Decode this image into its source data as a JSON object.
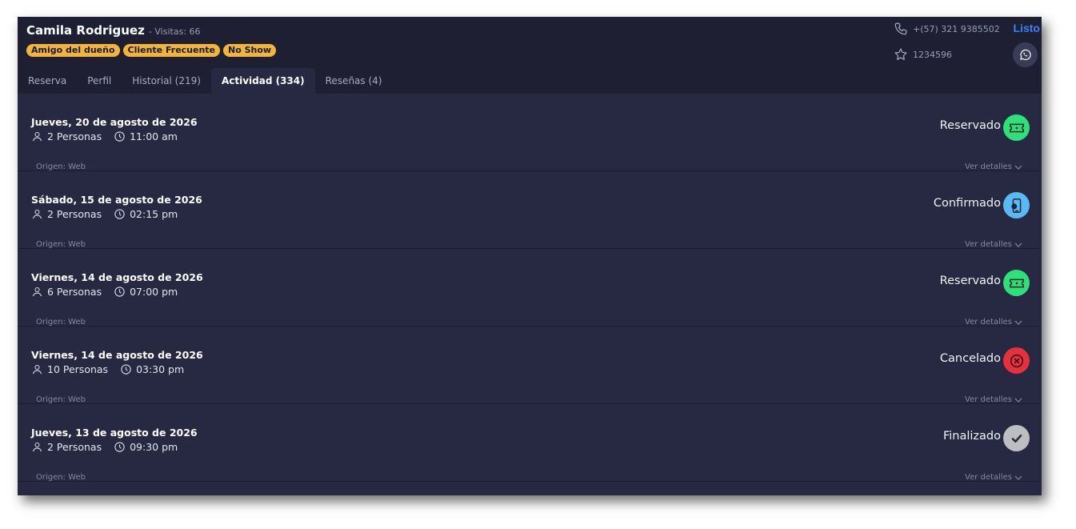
{
  "client": {
    "name": "Camila Rodriguez",
    "visits": "- Visitas: 66",
    "tags": [
      "Amigo del dueño",
      "Cliente Frecuente",
      "No Show"
    ],
    "phone": "+(57) 321 9385502",
    "member_id": "1234596",
    "done_label": "Listo"
  },
  "tabs": [
    {
      "label": "Reserva",
      "active": false
    },
    {
      "label": "Perfil",
      "active": false
    },
    {
      "label": "Historial (219)",
      "active": false
    },
    {
      "label": "Actividad (334)",
      "active": true
    },
    {
      "label": "Reseñas (4)",
      "active": false
    }
  ],
  "activity": [
    {
      "date": "Jueves, 20 de agosto de 2026",
      "people": "2 Personas",
      "time": "11:00 am",
      "origin": "Origen: Web",
      "status": "Reservado",
      "status_icon": "ticket-icon",
      "status_color": "#2fe07a",
      "details": "Ver detalles"
    },
    {
      "date": "Sábado, 15 de agosto de 2026",
      "people": "2 Personas",
      "time": "02:15 pm",
      "origin": "Origen: Web",
      "status": "Confirmado",
      "status_icon": "phone-confirm-icon",
      "status_color": "#5ab8f2",
      "details": "Ver detalles"
    },
    {
      "date": "Viernes, 14 de agosto de 2026",
      "people": "6 Personas",
      "time": "07:00 pm",
      "origin": "Origen: Web",
      "status": "Reservado",
      "status_icon": "ticket-icon",
      "status_color": "#2fe07a",
      "details": "Ver detalles"
    },
    {
      "date": "Viernes, 14 de agosto de 2026",
      "people": "10 Personas",
      "time": "03:30 pm",
      "origin": "Origen: Web",
      "status": "Cancelado",
      "status_icon": "cancel-icon",
      "status_color": "#e5313d",
      "details": "Ver detalles"
    },
    {
      "date": "Jueves, 13 de agosto de 2026",
      "people": "2 Personas",
      "time": "09:30 pm",
      "origin": "Origen: Web",
      "status": "Finalizado",
      "status_icon": "check-icon",
      "status_color": "#bdbdc4",
      "details": "Ver detalles"
    }
  ]
}
